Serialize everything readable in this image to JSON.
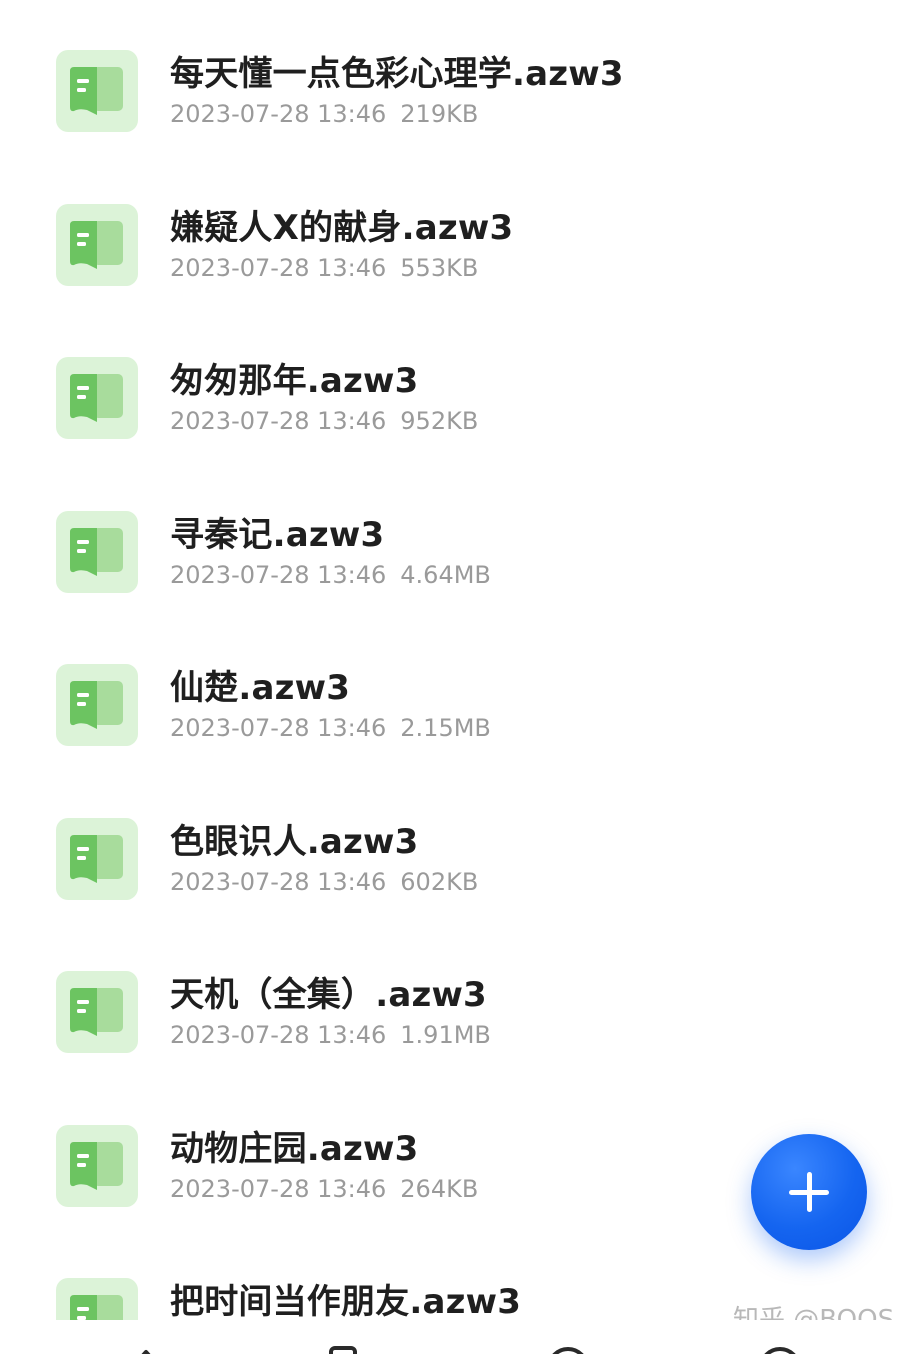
{
  "file_list": {
    "items": [
      {
        "name": "每天懂一点色彩心理学.azw3",
        "date": "2023-07-28 13:46",
        "size": "219KB"
      },
      {
        "name": "嫌疑人X的献身.azw3",
        "date": "2023-07-28 13:46",
        "size": "553KB"
      },
      {
        "name": "匆匆那年.azw3",
        "date": "2023-07-28 13:46",
        "size": "952KB"
      },
      {
        "name": "寻秦记.azw3",
        "date": "2023-07-28 13:46",
        "size": "4.64MB"
      },
      {
        "name": "仙楚.azw3",
        "date": "2023-07-28 13:46",
        "size": "2.15MB"
      },
      {
        "name": "色眼识人.azw3",
        "date": "2023-07-28 13:46",
        "size": "602KB"
      },
      {
        "name": "天机（全集）.azw3",
        "date": "2023-07-28 13:46",
        "size": "1.91MB"
      },
      {
        "name": "动物庄园.azw3",
        "date": "2023-07-28 13:46",
        "size": "264KB"
      },
      {
        "name": "把时间当作朋友.azw3",
        "date": "",
        "size": ""
      }
    ],
    "icon": "book-icon",
    "icon_colors": {
      "background": "#dcf3d8",
      "cover": "#6cc461",
      "page": "#a8dc9c"
    }
  },
  "fab": {
    "icon": "plus-icon",
    "color": "#1565f0"
  },
  "watermark": {
    "text": "知乎 @BOOS"
  },
  "bottom_nav": {
    "icons": [
      "home-icon",
      "book-icon",
      "circle-icon",
      "circle-icon"
    ]
  }
}
